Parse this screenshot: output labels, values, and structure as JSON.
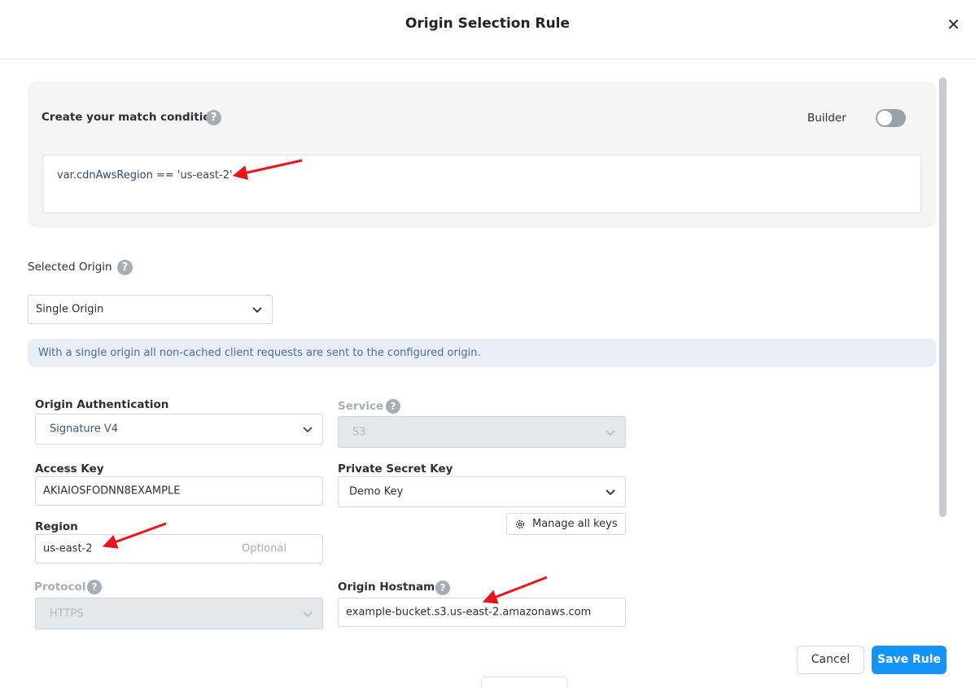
{
  "dialog": {
    "title": "Origin Selection Rule",
    "close_icon": "close-icon"
  },
  "condition": {
    "label": "Create your match condition",
    "help_glyph": "?",
    "builder_label": "Builder",
    "builder_enabled": false,
    "expression": "var.cdnAwsRegion == 'us-east-2'"
  },
  "selected_origin": {
    "label": "Selected Origin",
    "value": "Single Origin",
    "info": "With a single origin all non-cached client requests are sent to the configured origin."
  },
  "form": {
    "origin_auth": {
      "label": "Origin Authentication",
      "value": "Signature V4"
    },
    "service": {
      "label": "Service",
      "value": "S3",
      "disabled": true
    },
    "access_key": {
      "label": "Access Key",
      "value": "AKIAIOSFODNN8EXAMPLE"
    },
    "private_secret_key": {
      "label": "Private Secret Key",
      "value": "Demo Key"
    },
    "manage_keys_label": "Manage all keys",
    "region": {
      "label": "Region",
      "value": "us-east-2",
      "hint": "Optional"
    },
    "protocol": {
      "label": "Protocol",
      "value": "HTTPS",
      "disabled": true
    },
    "origin_hostname": {
      "label": "Origin Hostname",
      "value": "example-bucket.s3.us-east-2.amazonaws.com"
    }
  },
  "footer": {
    "cancel_label": "Cancel",
    "save_label": "Save Rule"
  },
  "colors": {
    "primary": "#1593f7",
    "annotation_arrow": "#e8161b",
    "info_bg": "#e9eef6"
  }
}
